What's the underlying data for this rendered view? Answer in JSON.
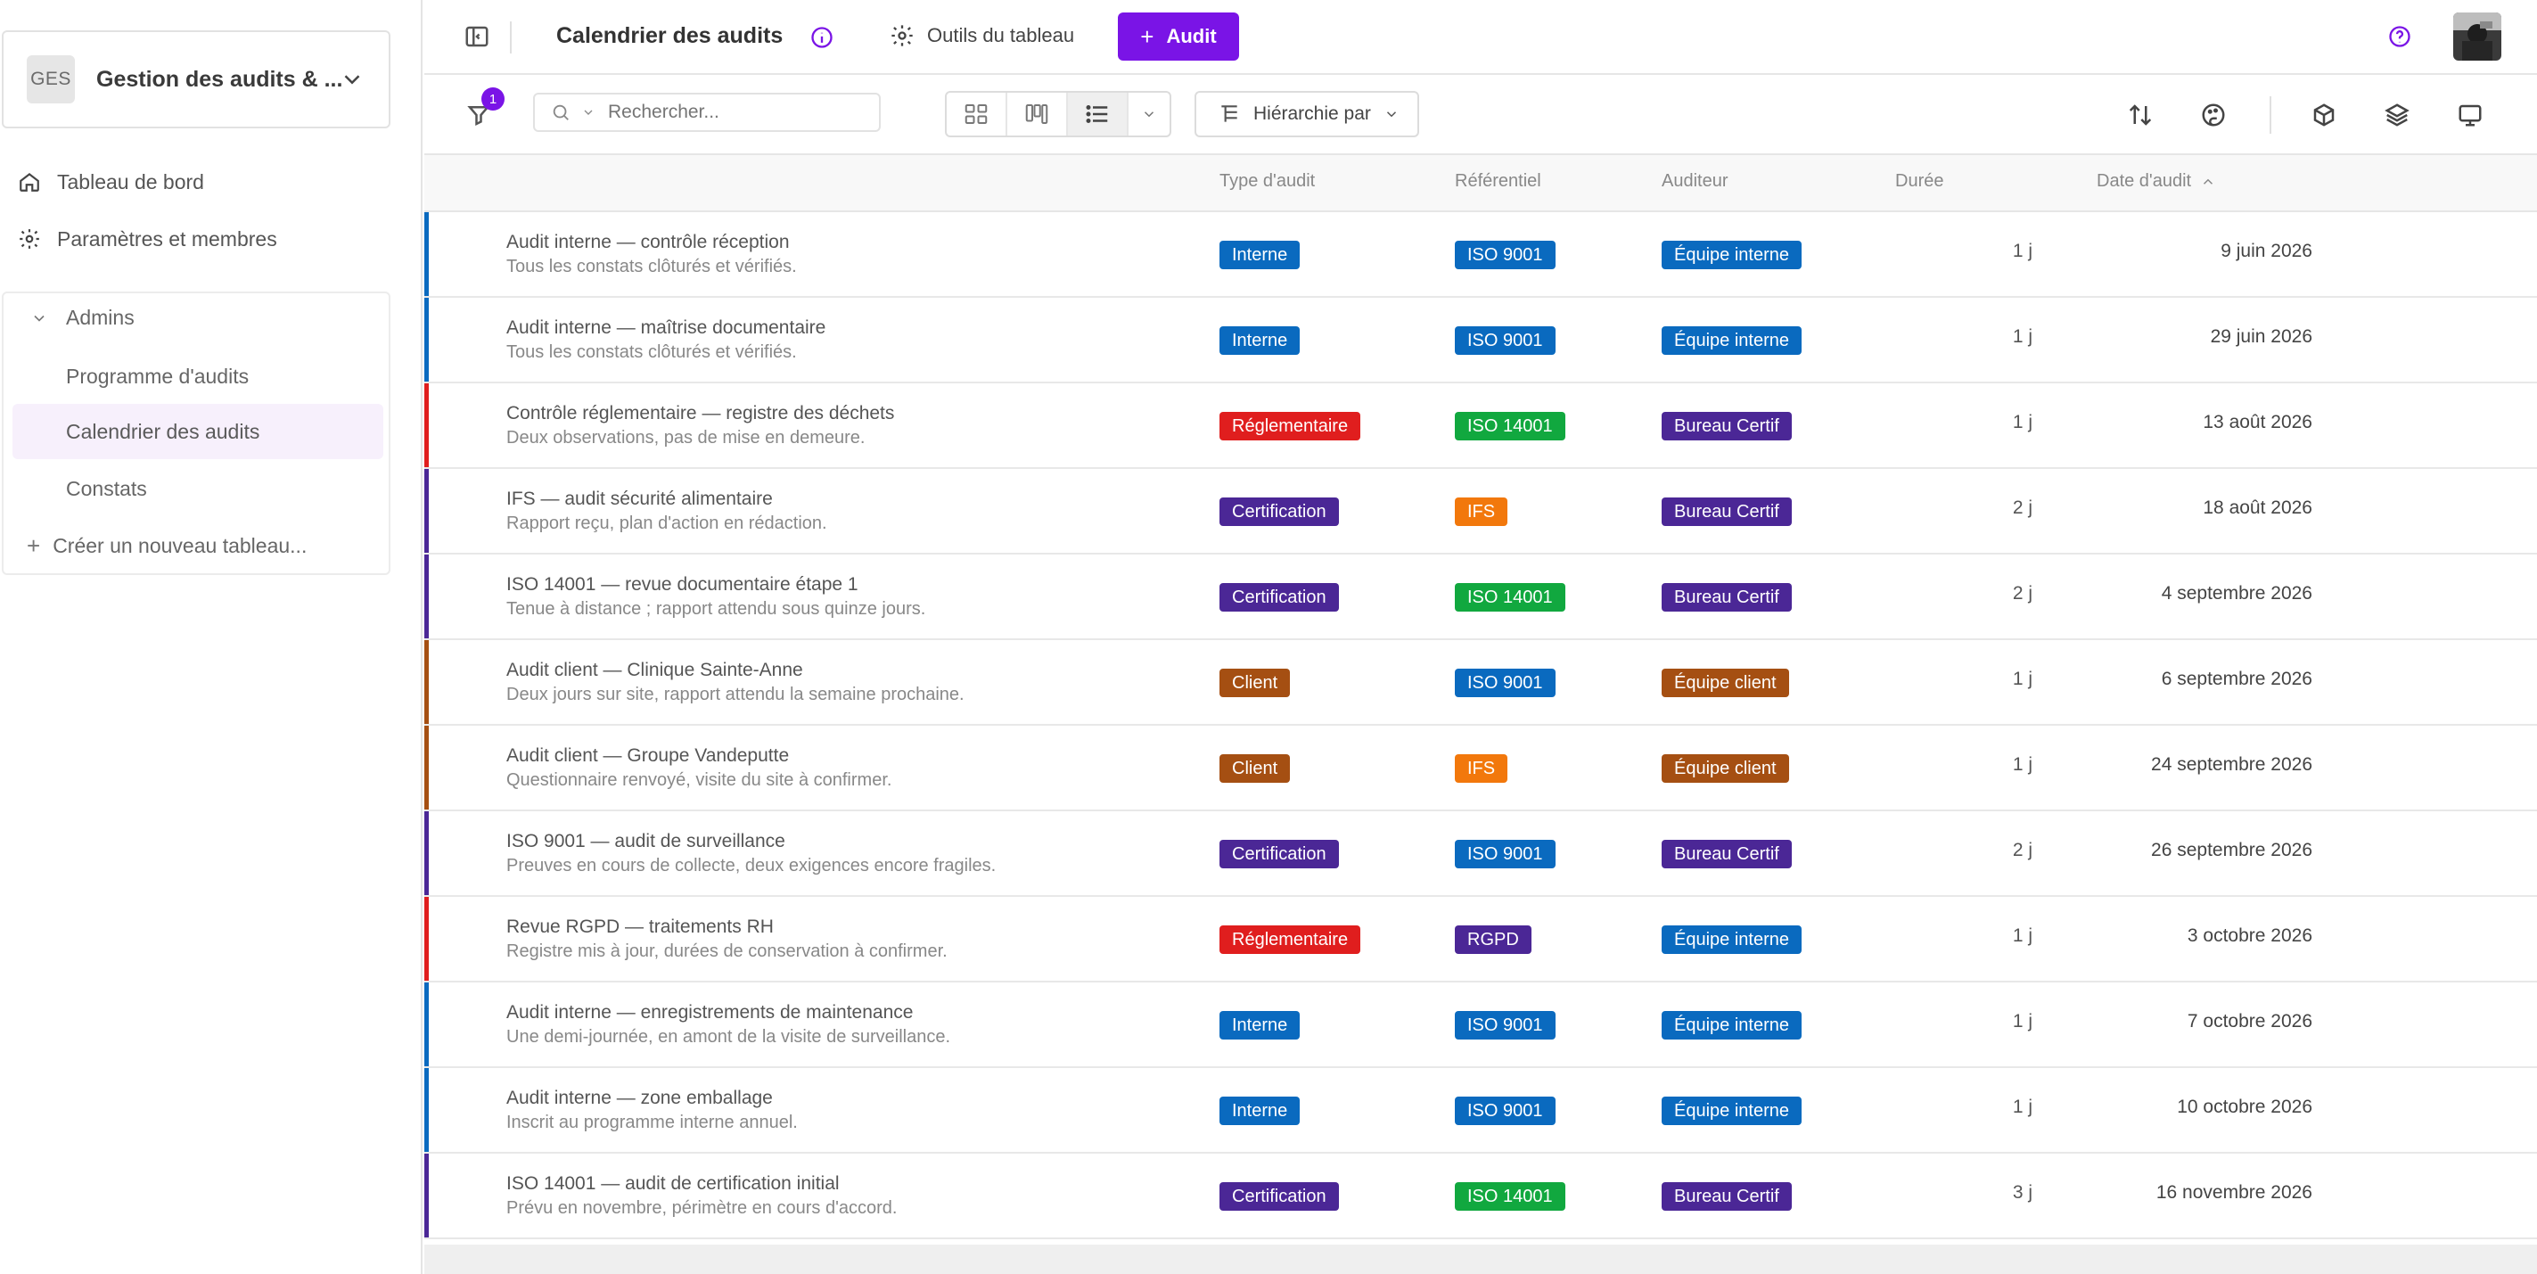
{
  "sidebar": {
    "workspace": {
      "initials": "GES",
      "name": "Gestion des audits & ..."
    },
    "nav": [
      {
        "label": "Tableau de bord",
        "icon": "home-icon"
      },
      {
        "label": "Paramètres et membres",
        "icon": "gear-icon"
      }
    ],
    "section": {
      "title": "Admins",
      "items": [
        {
          "label": "Programme d'audits",
          "active": false
        },
        {
          "label": "Calendrier des audits",
          "active": true
        },
        {
          "label": "Constats",
          "active": false
        }
      ],
      "create_label": "Créer un nouveau tableau..."
    }
  },
  "header": {
    "title": "Calendrier des audits",
    "tools_label": "Outils du tableau",
    "add_label": "Audit"
  },
  "toolbar": {
    "filter_count": "1",
    "search_placeholder": "Rechercher...",
    "hierarchy_label": "Hiérarchie par"
  },
  "table": {
    "columns": {
      "type": "Type d'audit",
      "referentiel": "Référentiel",
      "auditeur": "Auditeur",
      "duree": "Durée",
      "date": "Date d'audit"
    },
    "colors": {
      "Interne": "#0a6abf",
      "Réglementaire": "#e01e1e",
      "Certification": "#4b2796",
      "Client": "#a54f12",
      "ISO 9001": "#0a6abf",
      "ISO 14001": "#11a83f",
      "IFS": "#f2780c",
      "RGPD": "#4b2796",
      "Équipe interne": "#0a6abf",
      "Bureau Certif": "#4b2796",
      "Équipe client": "#a54f12"
    },
    "rows": [
      {
        "title": "Audit interne — contrôle réception",
        "desc": "Tous les constats clôturés et vérifiés.",
        "type": "Interne",
        "ref": "ISO 9001",
        "auditor": "Équipe interne",
        "duration": "1 j",
        "date": "9 juin 2026",
        "bar": "#0a6abf"
      },
      {
        "title": "Audit interne — maîtrise documentaire",
        "desc": "Tous les constats clôturés et vérifiés.",
        "type": "Interne",
        "ref": "ISO 9001",
        "auditor": "Équipe interne",
        "duration": "1 j",
        "date": "29 juin 2026",
        "bar": "#0a6abf"
      },
      {
        "title": "Contrôle réglementaire — registre des déchets",
        "desc": "Deux observations, pas de mise en demeure.",
        "type": "Réglementaire",
        "ref": "ISO 14001",
        "auditor": "Bureau Certif",
        "duration": "1 j",
        "date": "13 août 2026",
        "bar": "#e01e1e"
      },
      {
        "title": "IFS — audit sécurité alimentaire",
        "desc": "Rapport reçu, plan d'action en rédaction.",
        "type": "Certification",
        "ref": "IFS",
        "auditor": "Bureau Certif",
        "duration": "2 j",
        "date": "18 août 2026",
        "bar": "#4b2796"
      },
      {
        "title": "ISO 14001 — revue documentaire étape 1",
        "desc": "Tenue à distance ; rapport attendu sous quinze jours.",
        "type": "Certification",
        "ref": "ISO 14001",
        "auditor": "Bureau Certif",
        "duration": "2 j",
        "date": "4 septembre 2026",
        "bar": "#4b2796"
      },
      {
        "title": "Audit client — Clinique Sainte-Anne",
        "desc": "Deux jours sur site, rapport attendu la semaine prochaine.",
        "type": "Client",
        "ref": "ISO 9001",
        "auditor": "Équipe client",
        "duration": "1 j",
        "date": "6 septembre 2026",
        "bar": "#a54f12"
      },
      {
        "title": "Audit client — Groupe Vandeputte",
        "desc": "Questionnaire renvoyé, visite du site à confirmer.",
        "type": "Client",
        "ref": "IFS",
        "auditor": "Équipe client",
        "duration": "1 j",
        "date": "24 septembre 2026",
        "bar": "#a54f12"
      },
      {
        "title": "ISO 9001 — audit de surveillance",
        "desc": "Preuves en cours de collecte, deux exigences encore fragiles.",
        "type": "Certification",
        "ref": "ISO 9001",
        "auditor": "Bureau Certif",
        "duration": "2 j",
        "date": "26 septembre 2026",
        "bar": "#4b2796"
      },
      {
        "title": "Revue RGPD — traitements RH",
        "desc": "Registre mis à jour, durées de conservation à confirmer.",
        "type": "Réglementaire",
        "ref": "RGPD",
        "auditor": "Équipe interne",
        "duration": "1 j",
        "date": "3 octobre 2026",
        "bar": "#e01e1e"
      },
      {
        "title": "Audit interne — enregistrements de maintenance",
        "desc": "Une demi-journée, en amont de la visite de surveillance.",
        "type": "Interne",
        "ref": "ISO 9001",
        "auditor": "Équipe interne",
        "duration": "1 j",
        "date": "7 octobre 2026",
        "bar": "#0a6abf"
      },
      {
        "title": "Audit interne — zone emballage",
        "desc": "Inscrit au programme interne annuel.",
        "type": "Interne",
        "ref": "ISO 9001",
        "auditor": "Équipe interne",
        "duration": "1 j",
        "date": "10 octobre 2026",
        "bar": "#0a6abf"
      },
      {
        "title": "ISO 14001 — audit de certification initial",
        "desc": "Prévu en novembre, périmètre en cours d'accord.",
        "type": "Certification",
        "ref": "ISO 14001",
        "auditor": "Bureau Certif",
        "duration": "3 j",
        "date": "16 novembre 2026",
        "bar": "#4b2796"
      }
    ]
  }
}
